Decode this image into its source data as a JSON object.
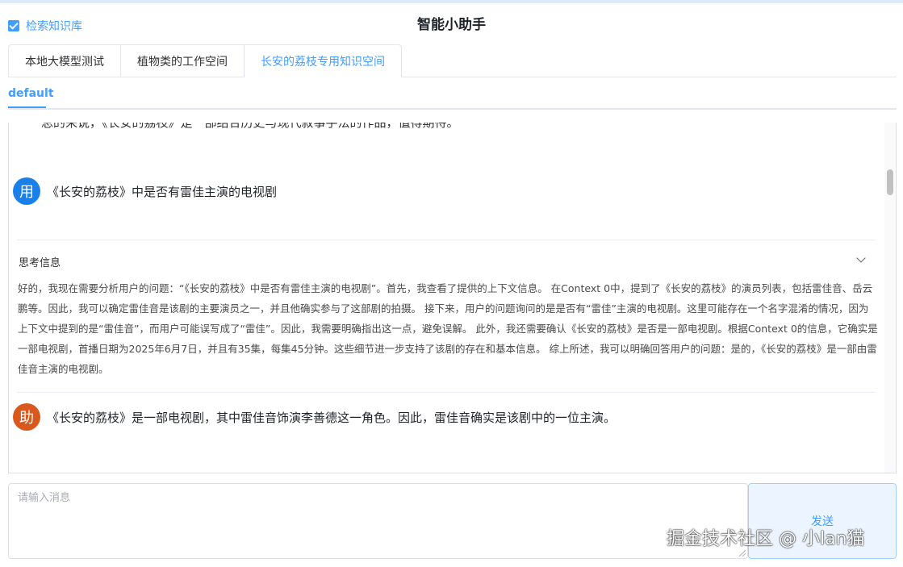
{
  "header": {
    "kb_checkbox_label": "检索知识库",
    "title": "智能小助手"
  },
  "tabs": [
    {
      "label": "本地大模型测试",
      "active": false
    },
    {
      "label": "植物类的工作空间",
      "active": false
    },
    {
      "label": "长安的荔枝专用知识空间",
      "active": true
    }
  ],
  "subtab": {
    "label": "default"
  },
  "chat": {
    "previous_cut_text": "总的来说，《长安的荔枝》是一部结合历史与现代叙事手法的作品，值得期待。",
    "user_message": {
      "avatar": "用",
      "text": "《长安的荔枝》中是否有雷佳主演的电视剧"
    },
    "thinking": {
      "header": "思考信息",
      "body": "好的，我现在需要分析用户的问题：“《长安的荔枝》中是否有雷佳主演的电视剧”。首先，我查看了提供的上下文信息。 在Context 0中，提到了《长安的荔枝》的演员列表，包括雷佳音、岳云鹏等。因此，我可以确定雷佳音是该剧的主要演员之一，并且他确实参与了这部剧的拍摄。 接下来，用户的问题询问的是是否有“雷佳”主演的电视剧。这里可能存在一个名字混淆的情况，因为上下文中提到的是“雷佳音”，而用户可能误写成了“雷佳”。因此，我需要明确指出这一点，避免误解。 此外，我还需要确认《长安的荔枝》是否是一部电视剧。根据Context 0的信息，它确实是一部电视剧，首播日期为2025年6月7日，并且有35集，每集45分钟。这些细节进一步支持了该剧的存在和基本信息。 综上所述，我可以明确回答用户的问题：是的，《长安的荔枝》是一部由雷佳音主演的电视剧。"
    },
    "bot_message": {
      "avatar": "助",
      "text": "《长安的荔枝》是一部电视剧，其中雷佳音饰演李善德这一角色。因此，雷佳音确实是该剧中的一位主演。"
    }
  },
  "input": {
    "placeholder": "请输入消息",
    "value": ""
  },
  "send_button": {
    "label": "发送"
  },
  "watermark": "掘金技术社区 @ 小lan猫",
  "colors": {
    "accent": "#409eff",
    "user_avatar": "#1a7fe6",
    "bot_avatar": "#d9581e"
  },
  "icons": {
    "checkbox": "check-icon",
    "collapse": "chevron-down-icon"
  }
}
